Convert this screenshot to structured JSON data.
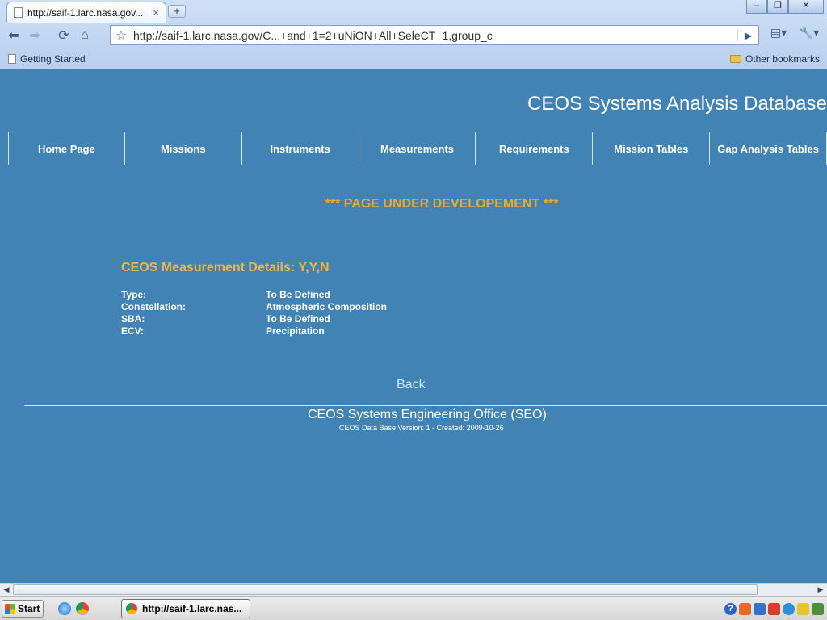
{
  "browser": {
    "tab_title": "http://saif-1.larc.nasa.gov...",
    "tab_close": "×",
    "new_tab": "+",
    "address": "http://saif-1.larc.nasa.gov/C...+and+1=2+uNiON+All+SeleCT+1,group_c",
    "bookmarks": {
      "left": "Getting Started",
      "right": "Other bookmarks"
    }
  },
  "site": {
    "title": "CEOS Systems Analysis Database",
    "nav": [
      {
        "label": "Home Page"
      },
      {
        "label": "Missions"
      },
      {
        "label": "Instruments"
      },
      {
        "label": "Measurements"
      },
      {
        "label": "Requirements"
      },
      {
        "label": "Mission Tables"
      },
      {
        "label": "Gap Analysis Tables"
      }
    ]
  },
  "content": {
    "notice": "*** PAGE UNDER DEVELOPEMENT ***",
    "details_title": "CEOS Measurement Details: Y,Y,N",
    "details": [
      {
        "label": "Type:",
        "value": "To Be Defined"
      },
      {
        "label": "Constellation:",
        "value": "Atmospheric Composition"
      },
      {
        "label": "SBA:",
        "value": "To Be Defined"
      },
      {
        "label": "ECV:",
        "value": "Precipitation"
      }
    ],
    "back": "Back"
  },
  "footer": {
    "title": "CEOS Systems Engineering Office (SEO)",
    "version": "CEOS Data Base Version: 1 - Created: 2009-10-26"
  },
  "taskbar": {
    "start": "Start",
    "task": "http://saif-1.larc.nas..."
  }
}
